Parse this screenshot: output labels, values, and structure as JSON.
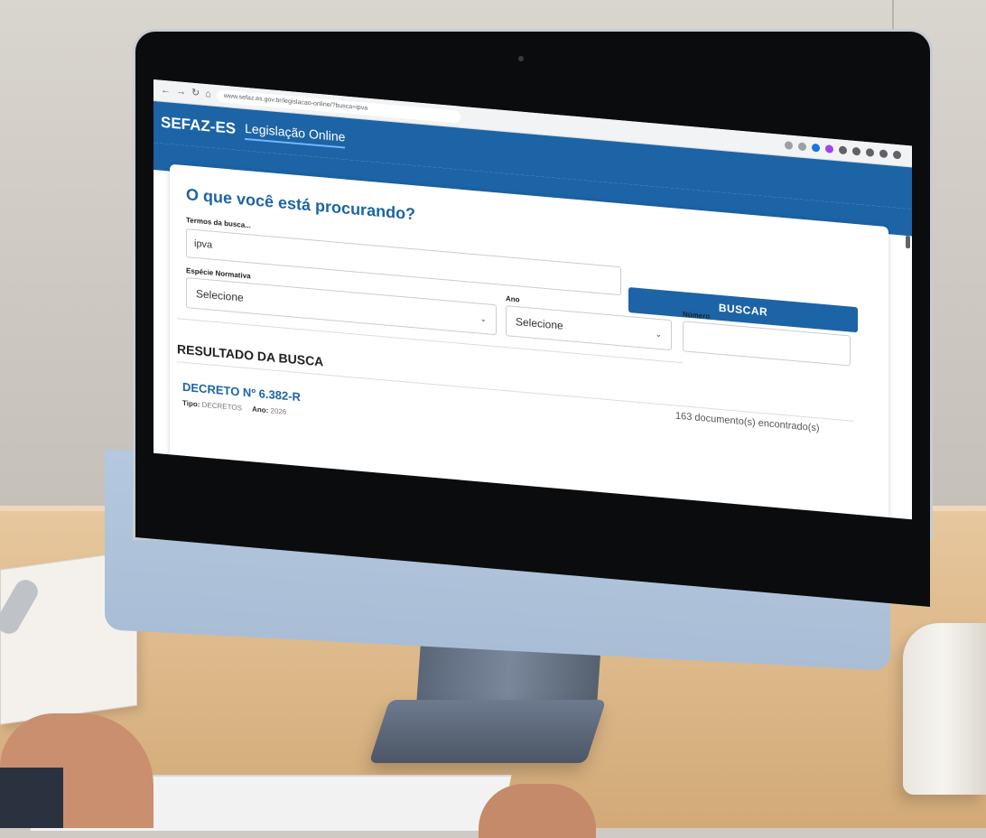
{
  "browser": {
    "url": "www.sefaz.es.gov.br/legislacao-online/?busca=ipva",
    "nav_icons": [
      "back-icon",
      "forward-icon",
      "reload-icon",
      "home-icon"
    ]
  },
  "app": {
    "brand": "SEFAZ-ES",
    "subtitle": "Legislação Online",
    "primary_color": "#1c64a6"
  },
  "search": {
    "title": "O que você está procurando?",
    "terms_label": "Termos da busca...",
    "terms_value": "ipva",
    "especie_label": "Espécie Normativa",
    "especie_value": "Selecione",
    "ano_label": "Ano",
    "ano_value": "Selecione",
    "numero_label": "Número",
    "numero_value": "",
    "button_label": "BUSCAR"
  },
  "results": {
    "section_title": "RESULTADO DA BUSCA",
    "count_text": "163 documento(s) encontrado(s)",
    "items": [
      {
        "title": "DECRETO Nº 6.382-R",
        "tipo_label": "Tipo:",
        "tipo_value": "DECRETOS",
        "ano_label": "Ano:",
        "ano_value": "2026"
      }
    ]
  }
}
